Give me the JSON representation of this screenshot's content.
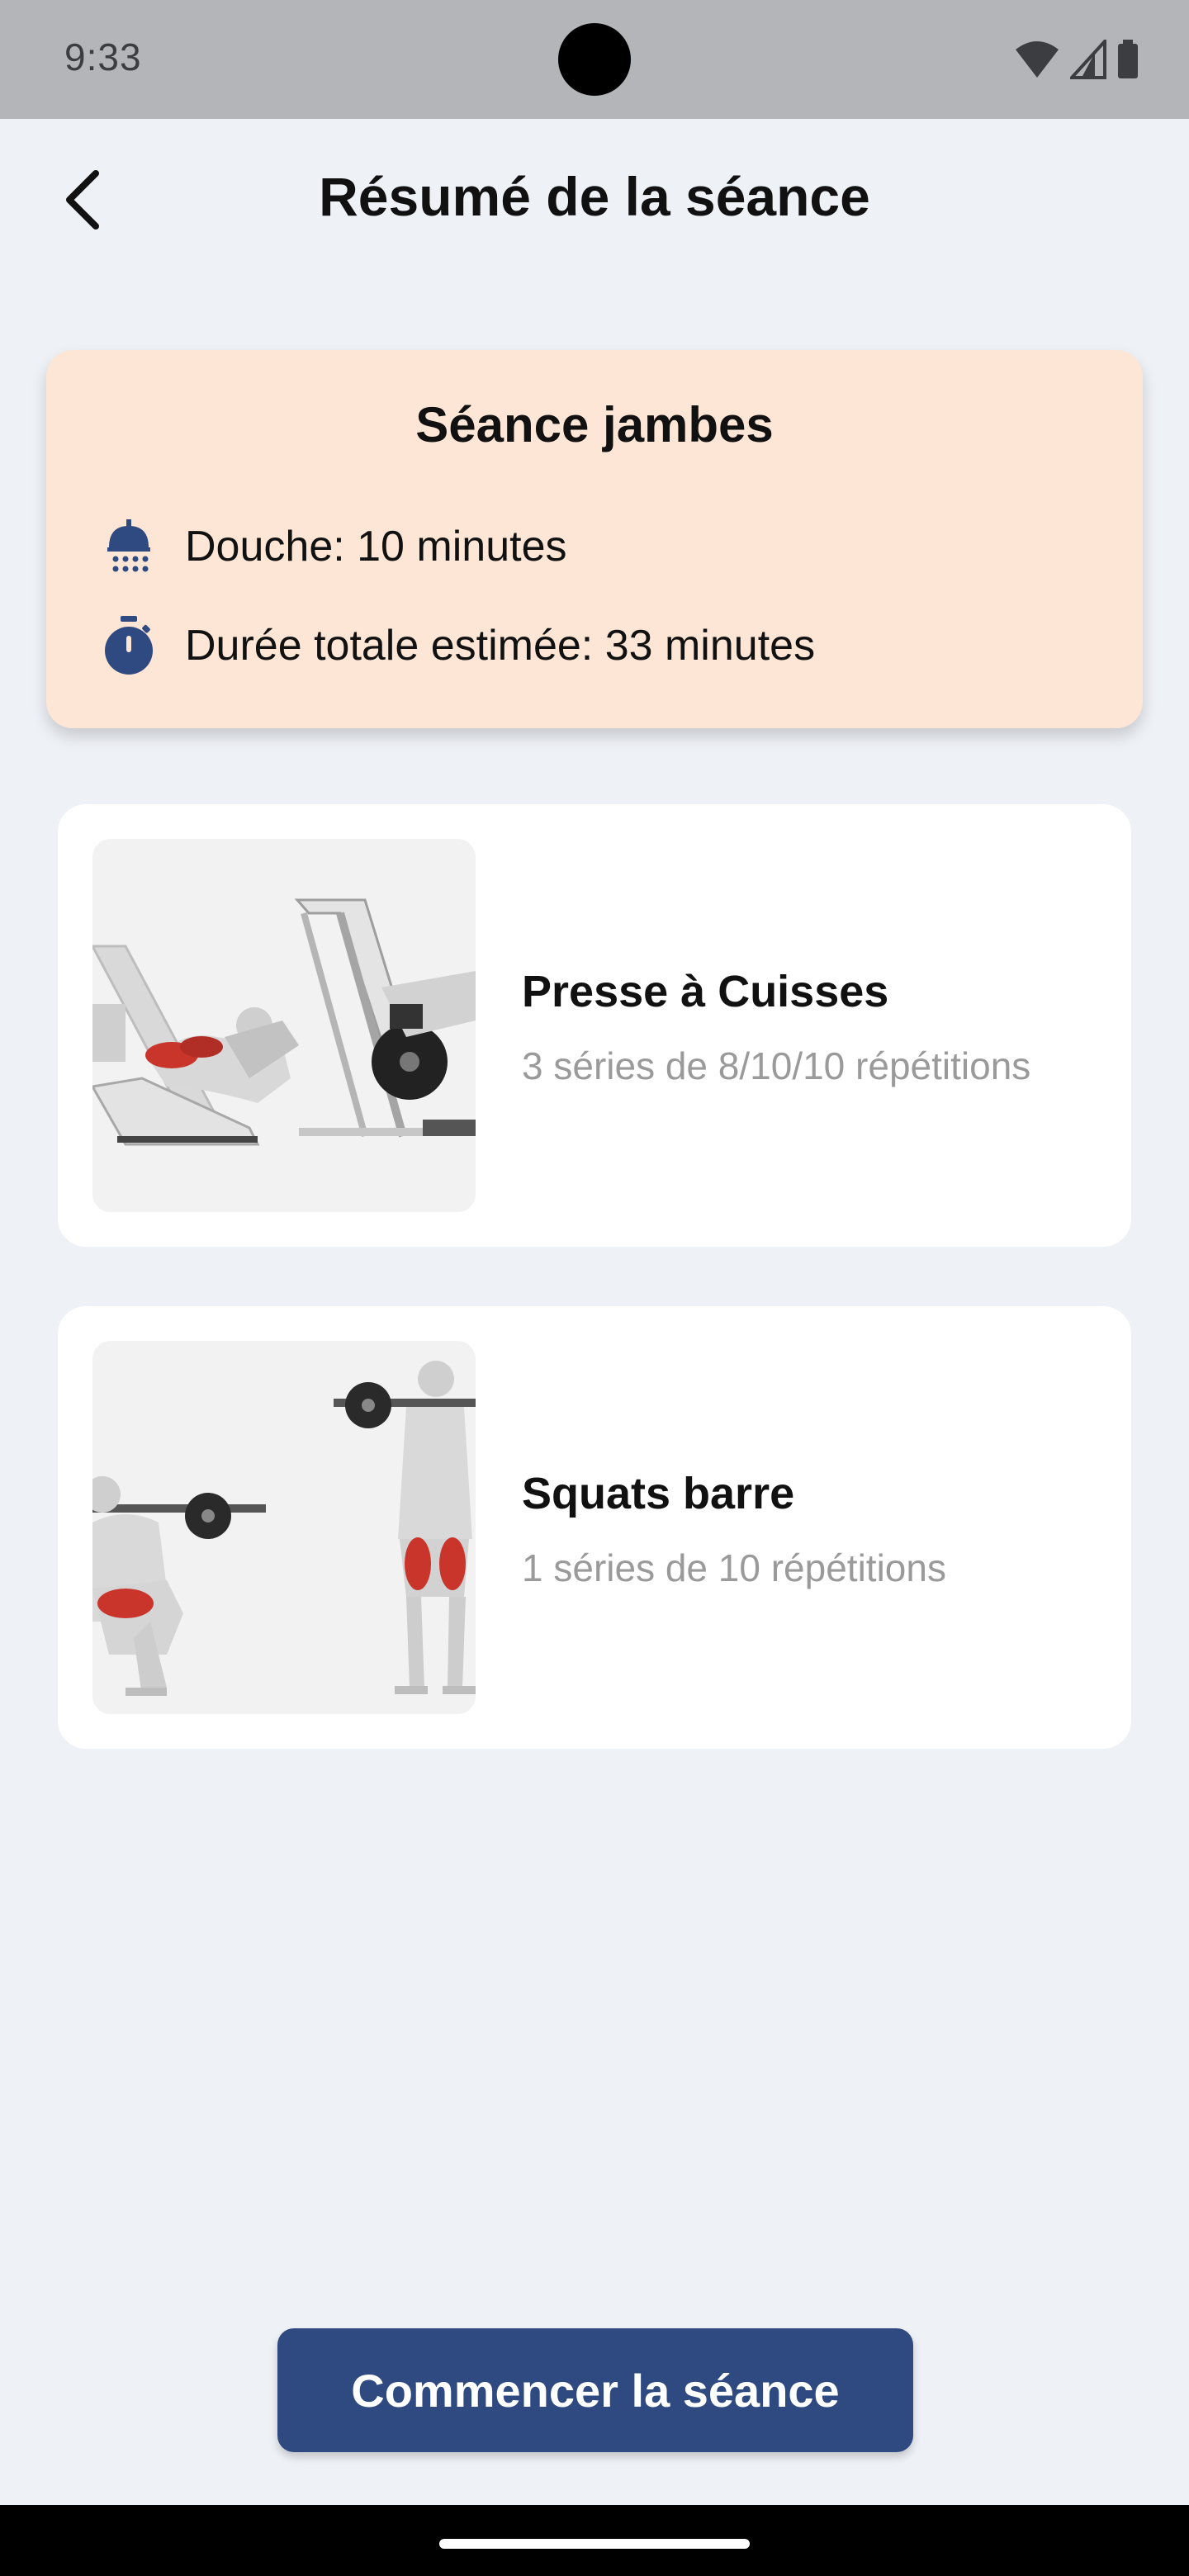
{
  "status_bar": {
    "time": "9:33"
  },
  "header": {
    "title": "Résumé de la séance",
    "back_icon": "chevron-left-icon"
  },
  "summary": {
    "title": "Séance jambes",
    "shower": {
      "icon": "shower-icon",
      "text": "Douche: 10 minutes"
    },
    "duration": {
      "icon": "stopwatch-icon",
      "text": "Durée totale estimée: 33 minutes"
    }
  },
  "exercises": [
    {
      "name": "Presse à Cuisses",
      "detail": "3 séries de 8/10/10 répétitions"
    },
    {
      "name": "Squats barre",
      "detail": "1 séries de 10 répétitions"
    }
  ],
  "actions": {
    "start_label": "Commencer la séance"
  },
  "colors": {
    "background": "#eef1f6",
    "summary_card": "#fde6d6",
    "accent": "#2e4a80",
    "muscle_highlight": "#c9352b"
  }
}
